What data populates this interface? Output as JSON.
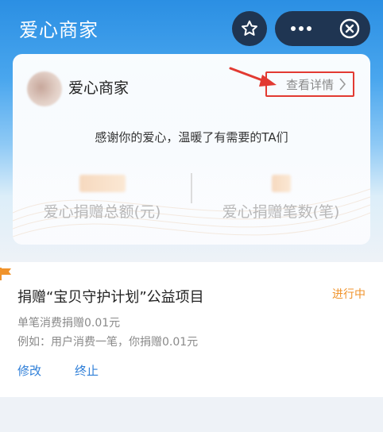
{
  "nav": {
    "title": "爱心商家",
    "star_icon": "star-icon",
    "more_icon": "more-dots-icon",
    "close_icon": "close-circle-icon"
  },
  "merchant_card": {
    "name": "爱心商家",
    "detail_label": "查看详情",
    "thanks_text": "感谢你的爱心，温暖了有需要的TA们",
    "stats": [
      {
        "label": "爱心捐赠总额(元)"
      },
      {
        "label": "爱心捐赠笔数(笔)"
      }
    ]
  },
  "project": {
    "title": "捐赠“宝贝守护计划”公益项目",
    "status": "进行中",
    "rule": "单笔消费捐赠0.01元",
    "example": "例如：用户消费一笔，你捐赠0.01元",
    "actions": {
      "edit": "修改",
      "stop": "终止"
    }
  },
  "colors": {
    "header_blue": "#2b8fe3",
    "annotation_red": "#e23a32",
    "status_orange": "#f0932b",
    "link_blue": "#2f7fd8"
  }
}
